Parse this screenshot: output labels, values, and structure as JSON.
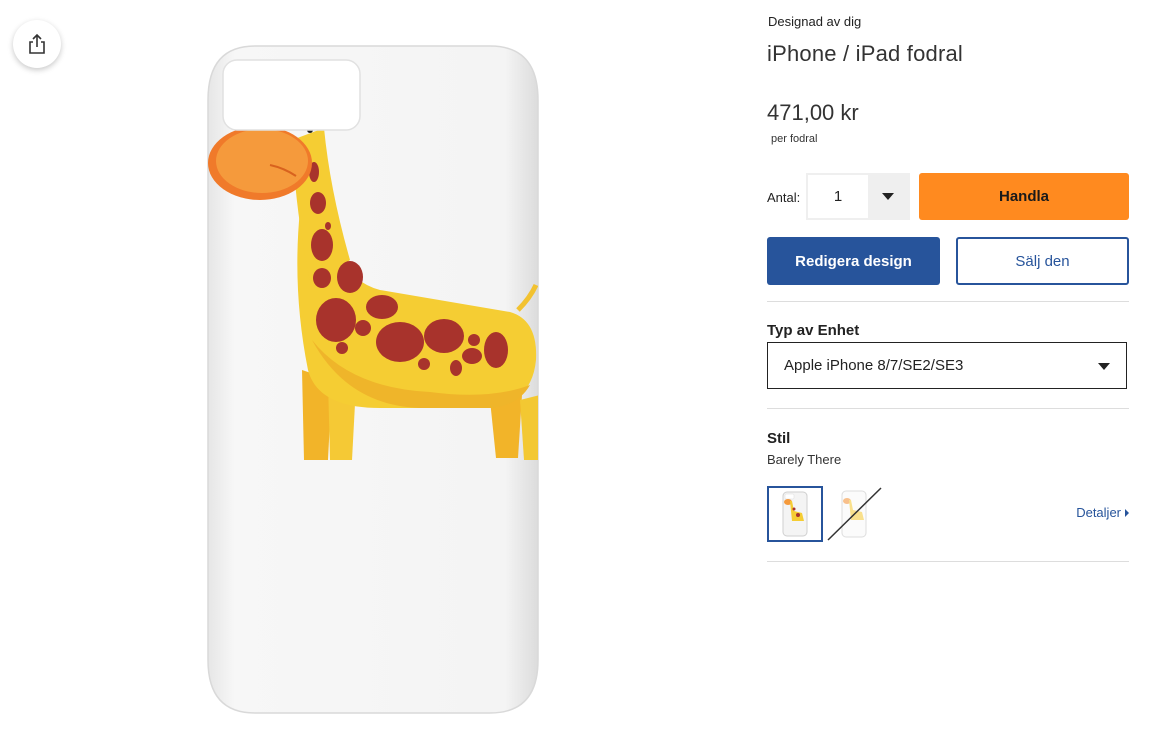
{
  "share": {
    "icon": "share-icon"
  },
  "product": {
    "designed_by": "Designad av dig",
    "title": "iPhone / iPad fodral",
    "price": "471,00 kr",
    "per_unit": "per fodral"
  },
  "purchase": {
    "quantity_label": "Antal:",
    "quantity_value": "1",
    "buy_label": "Handla",
    "edit_label": "Redigera design",
    "sell_label": "Sälj den"
  },
  "device": {
    "label": "Typ av Enhet",
    "selected": "Apple iPhone 8/7/SE2/SE3"
  },
  "style": {
    "label": "Stil",
    "selected": "Barely There",
    "details_label": "Detaljer"
  },
  "colors": {
    "accent_blue": "#27549b",
    "buy_orange": "#ff8a1f"
  }
}
